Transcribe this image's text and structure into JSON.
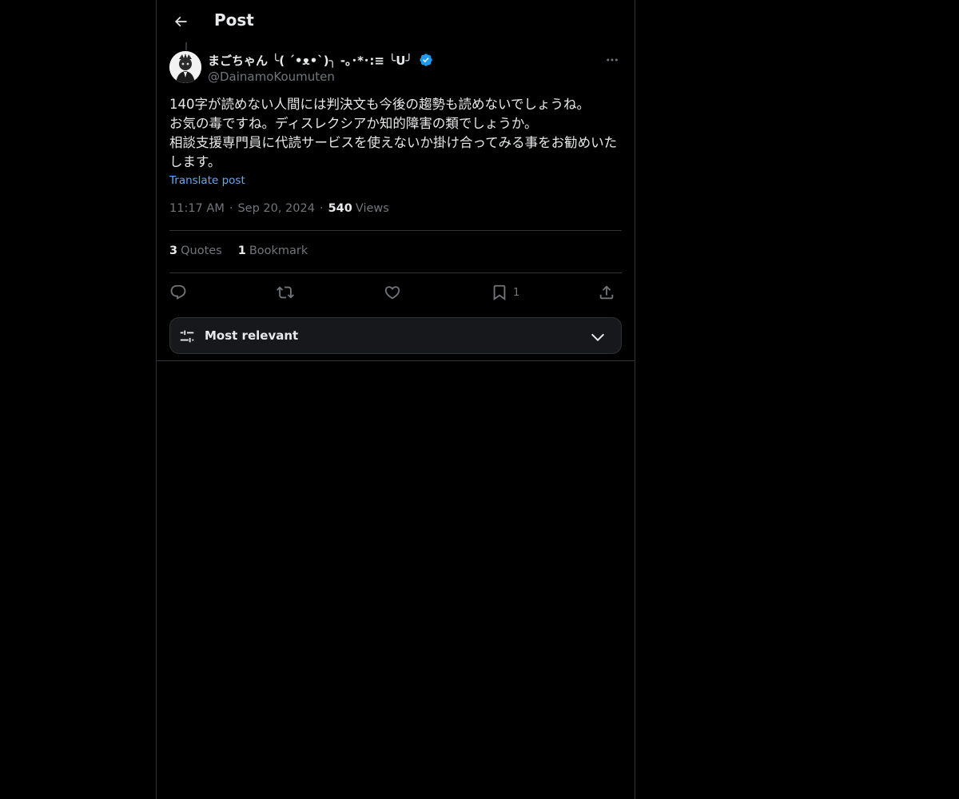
{
  "header": {
    "title": "Post"
  },
  "post": {
    "author": {
      "display_name": "まごちゃん ╰( ´•ᴥ•`)╮ -｡･*･:≡ ╰U╯",
      "handle": "@DainamoKoumuten",
      "verified": true
    },
    "text": "140字が読めない人間には判決文も今後の趨勢も読めないでしょうね。\nお気の毒ですね。ディスレクシアか知的障害の類でしょうか。\n相談支援専門員に代読サービスを使えないか掛け合ってみる事をお勧めいたします。",
    "translate_label": "Translate post",
    "time": "11:17 AM",
    "date": "Sep 20, 2024",
    "views_count": "540",
    "views_label": "Views",
    "stats": {
      "quotes_count": "3",
      "quotes_label": "Quotes",
      "bookmarks_count": "1",
      "bookmarks_label": "Bookmark"
    },
    "actions": {
      "bookmark_count": "1"
    }
  },
  "replies_sort": {
    "label": "Most relevant"
  },
  "colors": {
    "background": "#000000",
    "border": "#2f3336",
    "text_primary": "#e7e9ea",
    "text_secondary": "#71767b",
    "link": "#6aa8f0",
    "verified": "#1d9bf0"
  },
  "icons": [
    "back-arrow-icon",
    "verified-badge-icon",
    "more-icon",
    "reply-icon",
    "repost-icon",
    "like-icon",
    "bookmark-icon",
    "share-icon",
    "sort-settings-icon",
    "chevron-down-icon"
  ]
}
